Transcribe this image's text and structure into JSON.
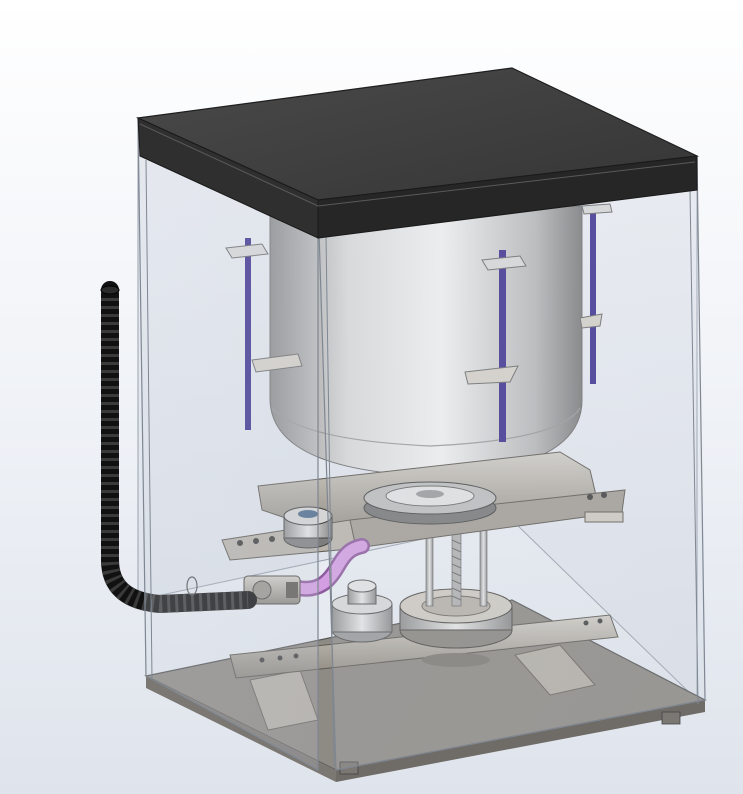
{
  "scene": {
    "subject": "cad-assembly-washing-machine",
    "colors": {
      "background_top": "#ffffff",
      "background_bottom": "#dfe4ec",
      "lid": "#3d3d3d",
      "lid_edge": "#2a2a2a",
      "glass": "#c9d0da",
      "drum": "#c8c8c8",
      "bracket": "#a9a49b",
      "rod": "#3b2f8f",
      "hose": "#1f1f1f",
      "pipe": "#c58ad6"
    }
  }
}
